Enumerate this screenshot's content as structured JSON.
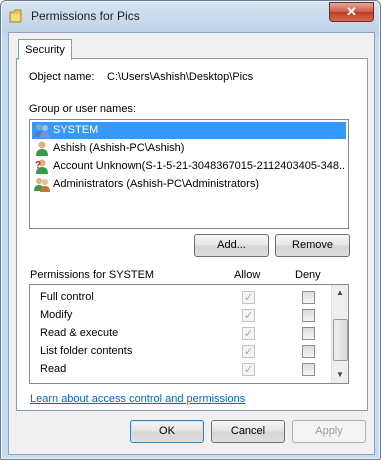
{
  "window": {
    "title": "Permissions for Pics",
    "close_glyph": "✕"
  },
  "tabs": [
    {
      "label": "Security"
    }
  ],
  "object": {
    "label": "Object name:",
    "value": "C:\\Users\\Ashish\\Desktop\\Pics"
  },
  "groups": {
    "label": "Group or user names:",
    "items": [
      {
        "label": "SYSTEM",
        "icon": "users-group-icon",
        "selected": true
      },
      {
        "label": "Ashish (Ashish-PC\\Ashish)",
        "icon": "user-icon",
        "selected": false
      },
      {
        "label": "Account Unknown(S-1-5-21-3048367015-2112403405-348...",
        "icon": "unknown-user-icon",
        "selected": false
      },
      {
        "label": "Administrators (Ashish-PC\\Administrators)",
        "icon": "users-group-icon",
        "selected": false
      }
    ],
    "add_label": "Add...",
    "remove_label": "Remove"
  },
  "permissions": {
    "header": "Permissions for SYSTEM",
    "allow_header": "Allow",
    "deny_header": "Deny",
    "rows": [
      {
        "name": "Full control",
        "allow": true,
        "deny": false
      },
      {
        "name": "Modify",
        "allow": true,
        "deny": false
      },
      {
        "name": "Read & execute",
        "allow": true,
        "deny": false
      },
      {
        "name": "List folder contents",
        "allow": true,
        "deny": false
      },
      {
        "name": "Read",
        "allow": true,
        "deny": false
      }
    ],
    "scroll_up_glyph": "▲",
    "scroll_down_glyph": "▼"
  },
  "link_text": "Learn about access control and permissions",
  "buttons": {
    "ok": "OK",
    "cancel": "Cancel",
    "apply": "Apply"
  },
  "colors": {
    "selection": "#3399ff",
    "link": "#0066cc",
    "close": "#c03b22"
  }
}
